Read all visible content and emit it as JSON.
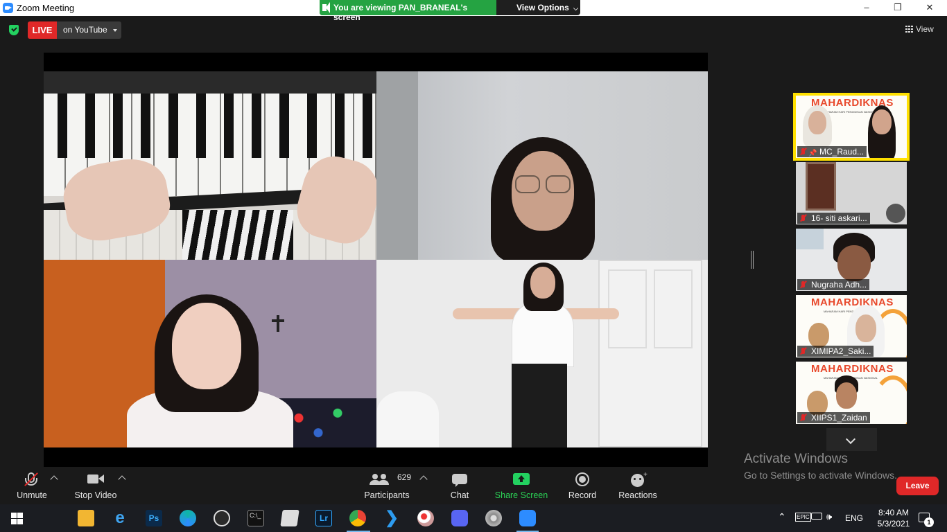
{
  "window": {
    "title": "Zoom Meeting",
    "controls": [
      "–",
      "❐",
      "✕"
    ]
  },
  "share_banner": {
    "viewing_text": "You are viewing PAN_BRANEAL's screen",
    "view_options_label": "View Options"
  },
  "top_bar": {
    "live_label": "LIVE",
    "stream_target": "on YouTube",
    "view_label": "View"
  },
  "participants_thumbs": [
    {
      "name": "MC_Raud...",
      "active": true,
      "type": "banner",
      "muted": true,
      "pinned": true
    },
    {
      "name": "16- siti askari...",
      "active": false,
      "type": "room",
      "muted": true
    },
    {
      "name": "Nugraha Adh...",
      "active": false,
      "type": "person",
      "muted": true
    },
    {
      "name": "XIMIPA2_Saki...",
      "active": false,
      "type": "banner",
      "muted": true
    },
    {
      "name": "XIIPS1_Zaidan",
      "active": false,
      "type": "banner",
      "muted": true
    }
  ],
  "banner_text": {
    "title": "MAHARDIKNAS",
    "subtitle": "MAHARAM HARI PENDIDIKAN NASIONAL"
  },
  "watermark": {
    "line1": "Activate Windows",
    "line2": "Go to Settings to activate Windows."
  },
  "toolbar": {
    "unmute": "Unmute",
    "stop_video": "Stop Video",
    "participants_label": "Participants",
    "participants_count": "629",
    "chat": "Chat",
    "share_screen": "Share Screen",
    "record": "Record",
    "reactions": "Reactions",
    "leave": "Leave"
  },
  "taskbar": {
    "apps": [
      "file-explorer",
      "internet-explorer",
      "photoshop",
      "edge",
      "obs",
      "terminal",
      "sticky-app",
      "lightroom",
      "chrome",
      "vscode",
      "paint-app",
      "discord",
      "audio-app",
      "zoom"
    ],
    "language": "ENG",
    "time": "8:40 AM",
    "date": "5/3/2021",
    "notification_count": "1"
  },
  "colors": {
    "accent_green": "#25a342",
    "live_red": "#e02828",
    "active_border": "#ffe000",
    "share_green": "#23d160",
    "banner_red": "#e8482b"
  }
}
